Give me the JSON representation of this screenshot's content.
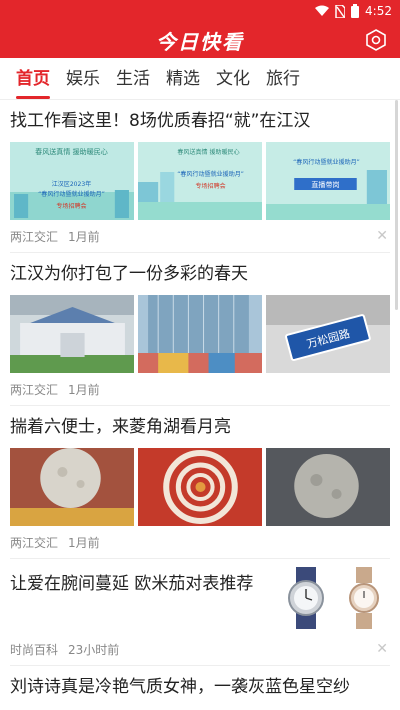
{
  "status": {
    "time": "4:52"
  },
  "app": {
    "title": "今日快看"
  },
  "tabs": [
    "首页",
    "娱乐",
    "生活",
    "精选",
    "文化",
    "旅行"
  ],
  "articles": [
    {
      "title": "找工作看这里！8场优质春招“就”在江汉",
      "source": "两江交汇",
      "time": "1月前",
      "images": [
        "banner-job-fair-1",
        "banner-job-fair-2",
        "banner-job-fair-3"
      ]
    },
    {
      "title": "江汉为你打包了一份多彩的春天",
      "source": "两江交汇",
      "time": "1月前",
      "images": [
        "building-aerial",
        "glass-tower",
        "street-sign-wansong"
      ]
    },
    {
      "title": "揣着六便士，来菱角湖看月亮",
      "source": "两江交汇",
      "time": "1月前",
      "images": [
        "moon-installation",
        "red-spiral-stairs",
        "moon-night"
      ]
    },
    {
      "title": "让爱在腕间蔓延 欧米茄对表推荐",
      "source": "时尚百科",
      "time": "23小时前",
      "images": [
        "mens-watch",
        "ladies-watch"
      ]
    },
    {
      "title": "刘诗诗真是冷艳气质女神，一袭灰蓝色星空纱",
      "source": "",
      "time": "",
      "images": []
    }
  ],
  "banner_text": {
    "line1": "春风送真情 援助暖民心",
    "line2": "江汉区2023年",
    "line3": "“春风行动暨就业援助月”",
    "line4": "专场招聘会",
    "live": "直播带岗",
    "sign": "万松园路"
  },
  "colors": {
    "brand": "#e3262b"
  }
}
